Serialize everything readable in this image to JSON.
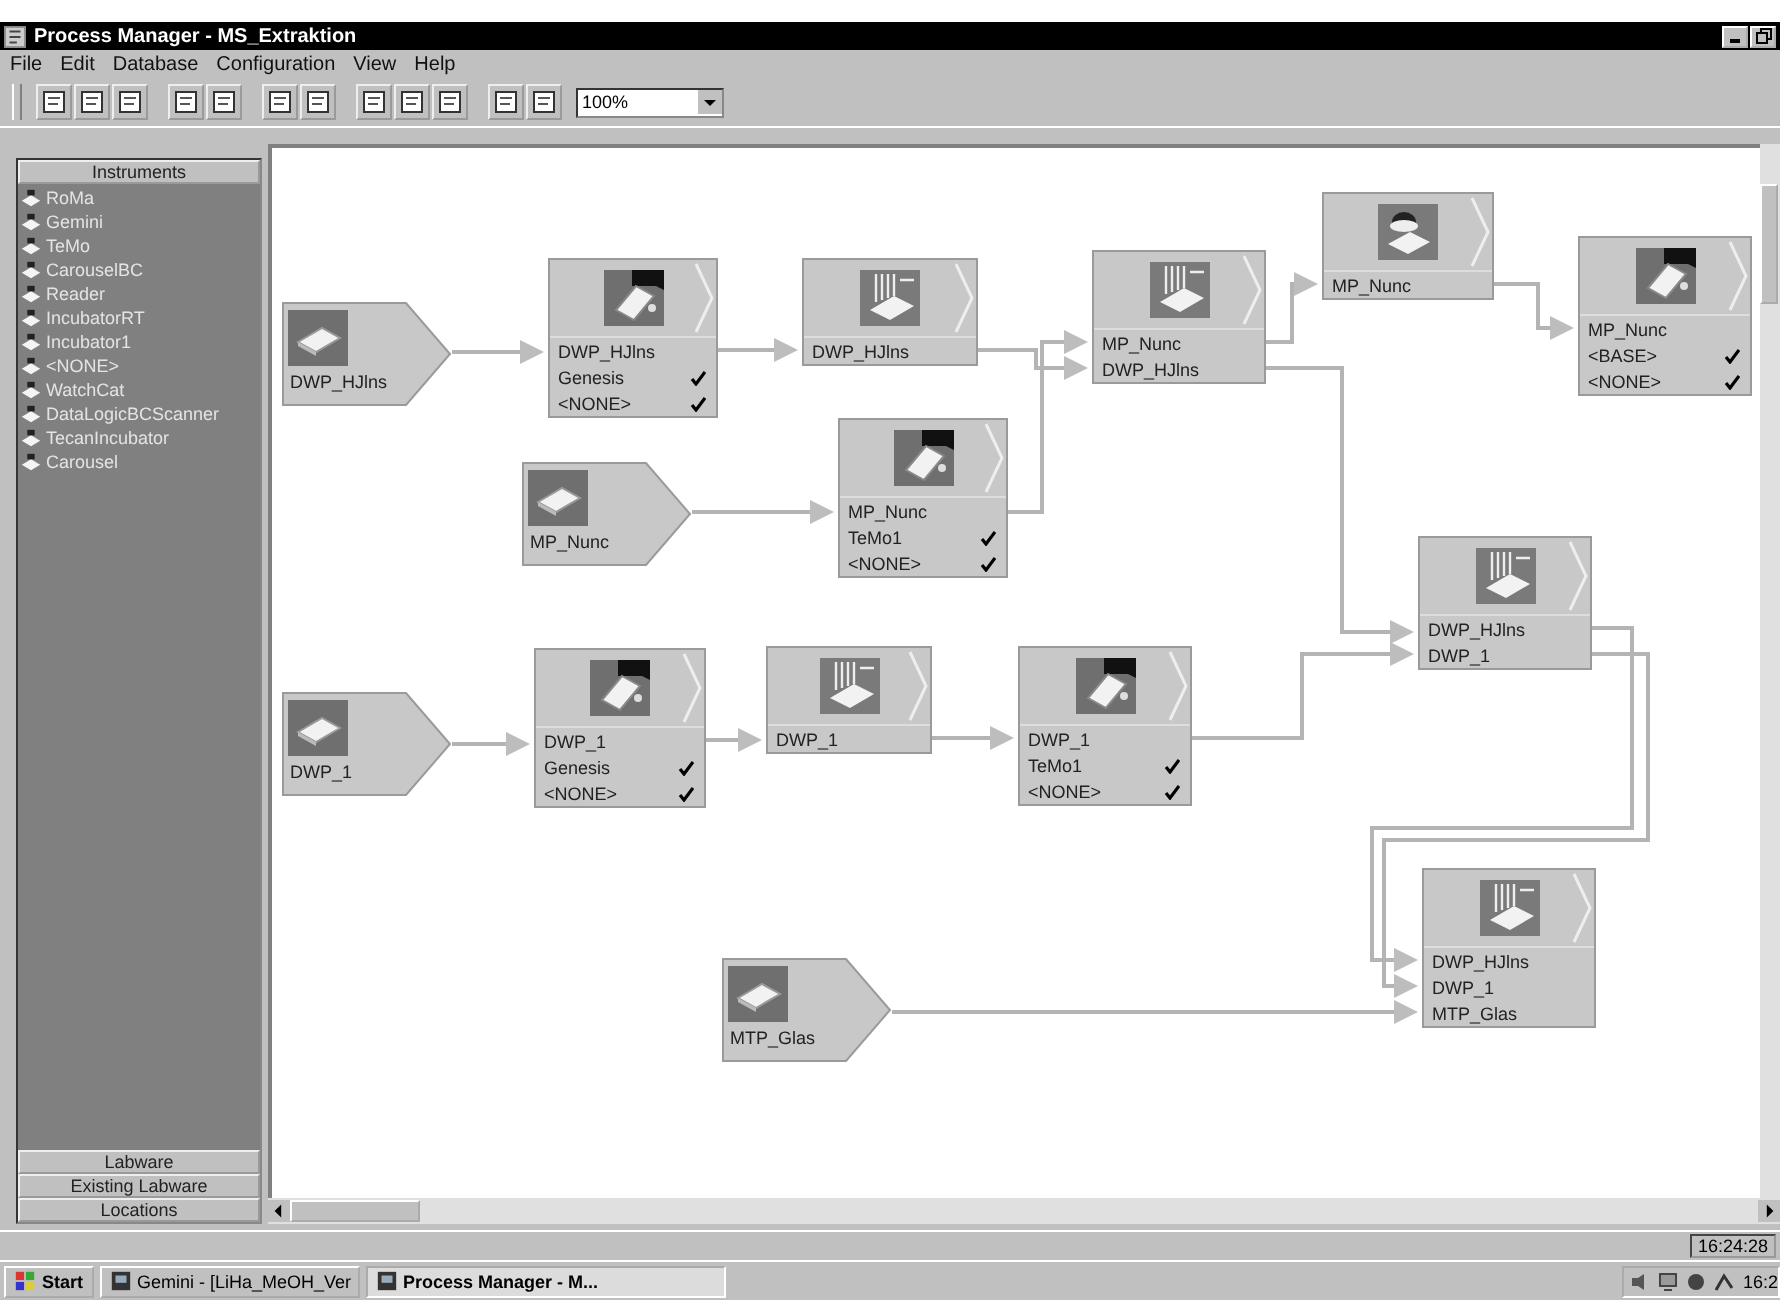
{
  "window": {
    "title": "Process Manager - MS_Extraktion"
  },
  "menu": [
    "File",
    "Edit",
    "Database",
    "Configuration",
    "View",
    "Help"
  ],
  "toolbar": {
    "zoom": "100%"
  },
  "sidebar": {
    "header": "Instruments",
    "items": [
      "RoMa",
      "Gemini",
      "TeMo",
      "CarouselBC",
      "Reader",
      "IncubatorRT",
      "Incubator1",
      "<NONE>",
      "WatchCat",
      "DataLogicBCScanner",
      "TecanIncubator",
      "Carousel"
    ],
    "buttons": [
      "Labware",
      "Existing Labware",
      "Locations"
    ]
  },
  "diagram": {
    "nodes": [
      {
        "kind": "source",
        "label": "DWP_HJlns"
      },
      {
        "kind": "step",
        "lines": [
          {
            "text": "DWP_HJlns",
            "checked": false
          },
          {
            "text": "Genesis",
            "checked": true
          },
          {
            "text": "<NONE>",
            "checked": true
          }
        ]
      },
      {
        "kind": "step",
        "lines": [
          {
            "text": "DWP_HJlns",
            "checked": false
          }
        ]
      },
      {
        "kind": "step",
        "lines": [
          {
            "text": "MP_Nunc",
            "checked": false
          },
          {
            "text": "DWP_HJlns",
            "checked": false
          }
        ]
      },
      {
        "kind": "step",
        "lines": [
          {
            "text": "MP_Nunc",
            "checked": false
          }
        ]
      },
      {
        "kind": "step",
        "lines": [
          {
            "text": "MP_Nunc",
            "checked": false
          },
          {
            "text": "<BASE>",
            "checked": true
          },
          {
            "text": "<NONE>",
            "checked": true
          }
        ]
      },
      {
        "kind": "source",
        "label": "MP_Nunc"
      },
      {
        "kind": "step",
        "lines": [
          {
            "text": "MP_Nunc",
            "checked": false
          },
          {
            "text": "TeMo1",
            "checked": true
          },
          {
            "text": "<NONE>",
            "checked": true
          }
        ]
      },
      {
        "kind": "step",
        "lines": [
          {
            "text": "DWP_HJlns",
            "checked": false
          },
          {
            "text": "DWP_1",
            "checked": false
          }
        ]
      },
      {
        "kind": "source",
        "label": "DWP_1"
      },
      {
        "kind": "step",
        "lines": [
          {
            "text": "DWP_1",
            "checked": false
          },
          {
            "text": "Genesis",
            "checked": true
          },
          {
            "text": "<NONE>",
            "checked": true
          }
        ]
      },
      {
        "kind": "step",
        "lines": [
          {
            "text": "DWP_1",
            "checked": false
          }
        ]
      },
      {
        "kind": "step",
        "lines": [
          {
            "text": "DWP_1",
            "checked": false
          },
          {
            "text": "TeMo1",
            "checked": true
          },
          {
            "text": "<NONE>",
            "checked": true
          }
        ]
      },
      {
        "kind": "step",
        "lines": [
          {
            "text": "DWP_HJlns",
            "checked": false
          },
          {
            "text": "DWP_1",
            "checked": false
          },
          {
            "text": "MTP_Glas",
            "checked": false
          }
        ]
      },
      {
        "kind": "source",
        "label": "MTP_Glas"
      }
    ]
  },
  "status_bar": {
    "time": "16:24:28"
  },
  "taskbar": {
    "start": "Start",
    "tasks": [
      {
        "label": "Gemini - [LiHa_MeOH_Ver",
        "selected": false
      },
      {
        "label": "Process Manager - M...",
        "selected": true
      }
    ],
    "clock": "16:2"
  }
}
